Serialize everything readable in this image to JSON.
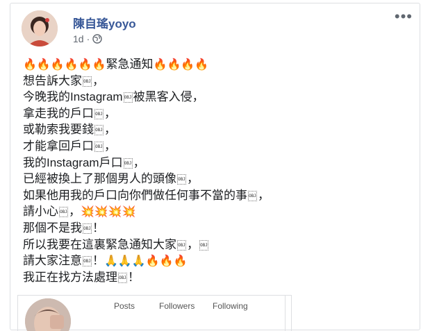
{
  "post": {
    "author": "陳自瑤yoyo",
    "time": "1d",
    "visibility_icon": "globe-icon",
    "more_icon": "more-options-icon",
    "more_label": "•••"
  },
  "body_lines": [
    {
      "pre": "🔥🔥🔥🔥🔥🔥",
      "text": "緊急通知",
      "post": "🔥🔥🔥🔥"
    },
    {
      "text": "想告訴大家",
      "orc": "OBJ",
      "tail": "，"
    },
    {
      "text": "今晚我的Instagram",
      "orc": "OBJ",
      "tail": "被黑客入侵，"
    },
    {
      "text": "拿走我的戶口",
      "orc": "OBJ",
      "tail": "，"
    },
    {
      "text": "或勒索我要錢",
      "orc": "OBJ",
      "tail": "，"
    },
    {
      "text": "才能拿回戶口",
      "orc": "OBJ",
      "tail": "，"
    },
    {
      "text": "我的Instagram戶口",
      "orc": "OBJ",
      "tail": "，"
    },
    {
      "text": "已經被換上了那個男人的頭像",
      "orc": "OBJ",
      "tail": "，"
    },
    {
      "text": "如果他用我的戶口向你們做任何事不當的事",
      "orc": "OBJ",
      "tail": "，"
    },
    {
      "text": "請小心",
      "orc": "OBJ",
      "tail": "，",
      "post": "💥💥💥💥"
    },
    {
      "text": "那個不是我",
      "orc": "OBJ",
      "tail": "！"
    },
    {
      "text": "所以我要在這裏緊急通知大家",
      "orc": "OBJ",
      "tail": "，",
      "orc2": "OBJ"
    },
    {
      "text": "請大家注意",
      "orc": "OBJ",
      "tail": "！",
      "post": "🙏🙏🙏🔥🔥🔥"
    },
    {
      "text": "我正在找方法處理",
      "orc": "OBJ",
      "tail": "！"
    }
  ],
  "embed": {
    "posts_label": "Posts",
    "followers_label": "Followers",
    "following_label": "Following"
  }
}
